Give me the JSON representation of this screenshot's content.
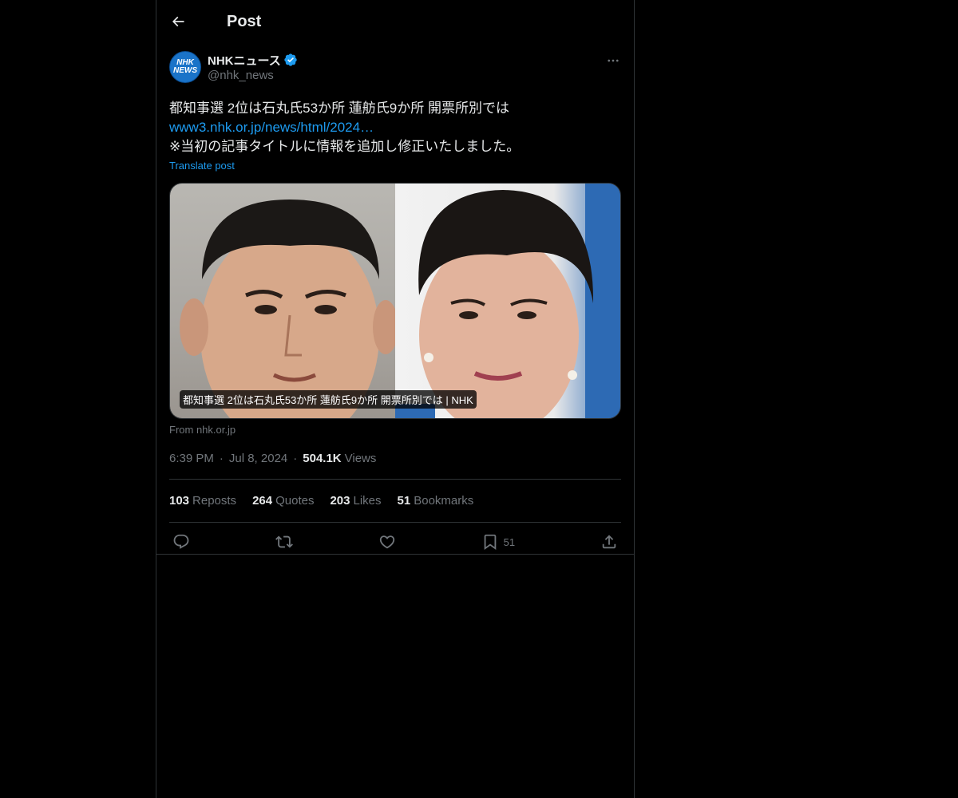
{
  "header": {
    "title": "Post",
    "back_icon": "arrow-left-icon"
  },
  "author": {
    "name": "NHKニュース",
    "handle": "@nhk_news",
    "avatar_text_top": "NHK",
    "avatar_text_bottom": "NEWS",
    "verified": true
  },
  "post": {
    "line1": "都知事選 2位は石丸氏53か所 蓮舫氏9か所 開票所別では",
    "link": "www3.nhk.or.jp/news/html/2024…",
    "line3": "※当初の記事タイトルに情報を追加し修正いたしました。",
    "translate_label": "Translate post"
  },
  "card": {
    "caption": "都知事選 2位は石丸氏53か所 蓮舫氏9か所 開票所別では | NHK",
    "source": "From nhk.or.jp"
  },
  "meta": {
    "time": "6:39 PM",
    "date": "Jul 8, 2024",
    "views_count": "504.1K",
    "views_label": "Views",
    "separator": "·"
  },
  "stats": {
    "reposts_count": "103",
    "reposts_label": "Reposts",
    "quotes_count": "264",
    "quotes_label": "Quotes",
    "likes_count": "203",
    "likes_label": "Likes",
    "bookmarks_count": "51",
    "bookmarks_label": "Bookmarks"
  },
  "actions": {
    "bookmark_count": "51"
  },
  "colors": {
    "background": "#000000",
    "text": "#e7e9ea",
    "muted": "#71767b",
    "link": "#1d9bf0",
    "border": "#2f3336",
    "avatar": "#1a73c8"
  }
}
